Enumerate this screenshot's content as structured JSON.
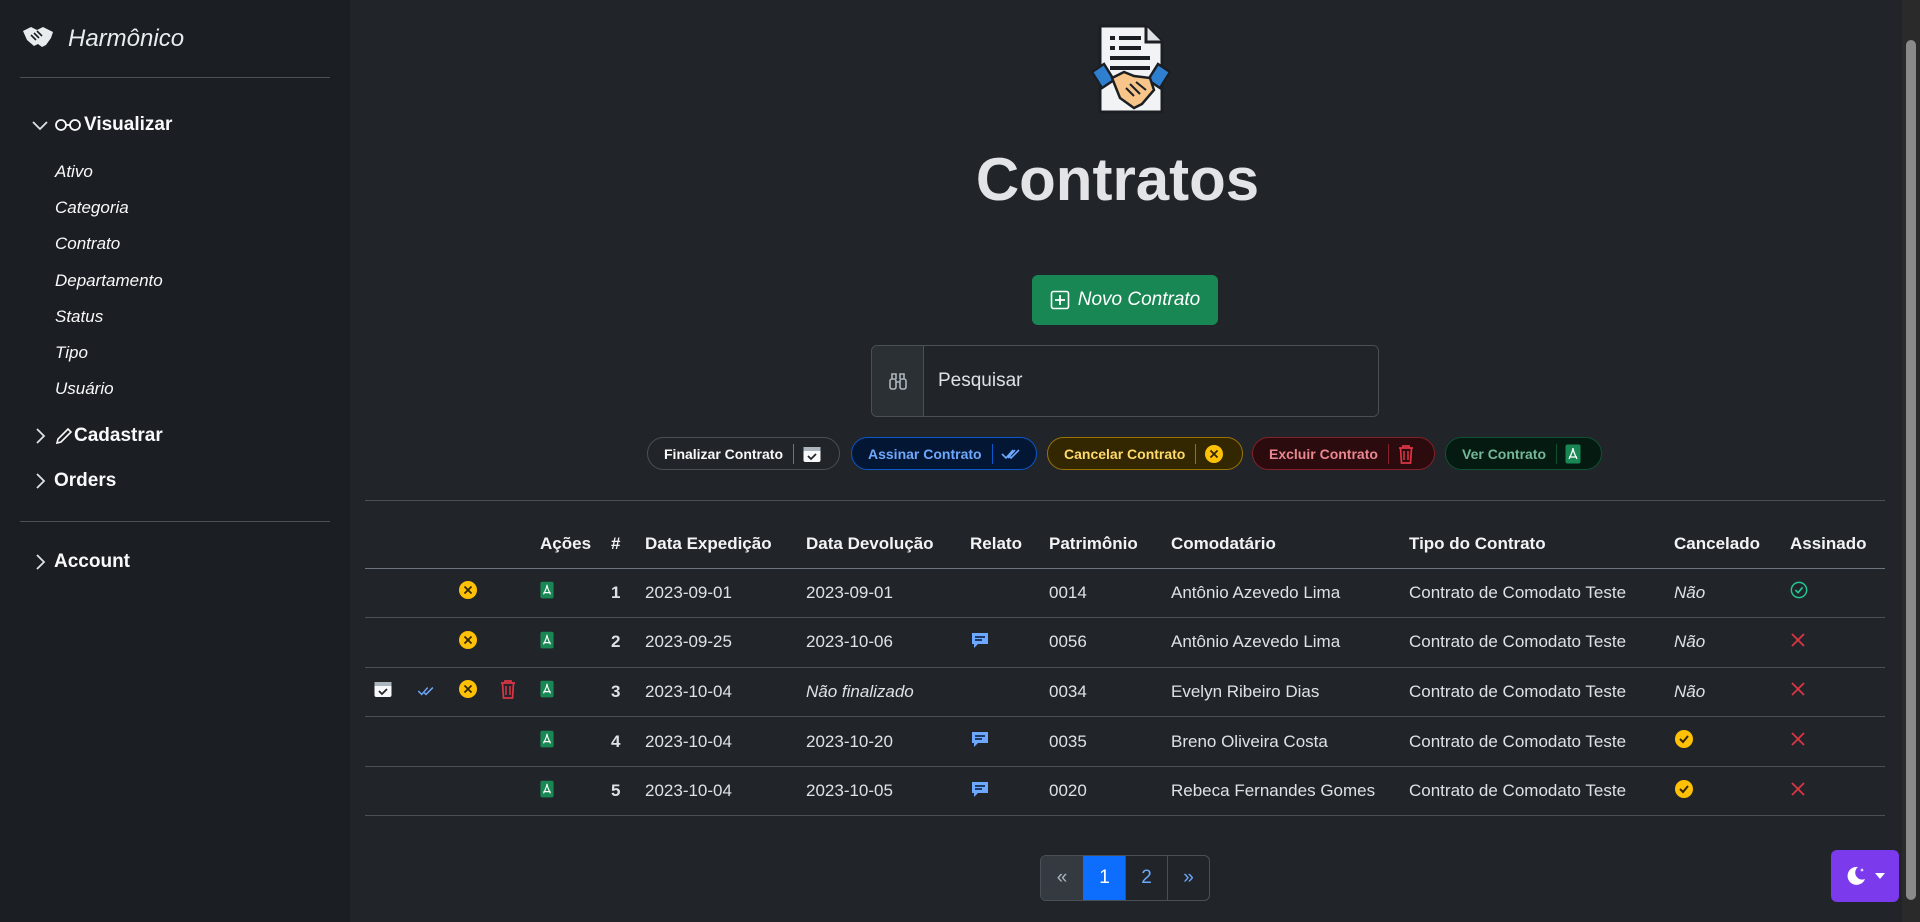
{
  "sidebar": {
    "brand": "Harmônico",
    "sections": {
      "visualizar": "Visualizar",
      "cadastrar": "Cadastrar",
      "orders": "Orders",
      "account": "Account"
    },
    "visualizar_items": [
      "Ativo",
      "Categoria",
      "Contrato",
      "Departamento",
      "Status",
      "Tipo",
      "Usuário"
    ]
  },
  "main": {
    "title": "Contratos",
    "new_button": "Novo Contrato",
    "search_placeholder": "Pesquisar"
  },
  "legend": [
    {
      "label": "Finalizar Contrato",
      "icon": "calendar-check-icon",
      "color": "#f8f9fa",
      "border": "#495057",
      "bg": "#212529"
    },
    {
      "label": "Assinar Contrato",
      "icon": "double-check-icon",
      "color": "#6ea8fe",
      "border": "#0a58ca",
      "bg": "#031633"
    },
    {
      "label": "Cancelar Contrato",
      "icon": "x-circle-fill-icon",
      "color": "#ffda6a",
      "border": "#997404",
      "bg": "#332701"
    },
    {
      "label": "Excluir Contrato",
      "icon": "trash-icon",
      "color": "#ea868f",
      "border": "#842029",
      "bg": "#2c0b0e"
    },
    {
      "label": "Ver Contrato",
      "icon": "file-pdf-icon",
      "color": "#75b798",
      "border": "#0f5132",
      "bg": "#051b11"
    }
  ],
  "table": {
    "headers": [
      "Ações",
      "#",
      "Data Expedição",
      "Data Devolução",
      "Relato",
      "Patrimônio",
      "Comodatário",
      "Tipo do Contrato",
      "Cancelado",
      "Assinado"
    ],
    "rows": [
      {
        "actions": {
          "finalize": false,
          "sign": false,
          "cancel": true,
          "delete": false,
          "view": true
        },
        "id": "1",
        "expedicao": "2023-09-01",
        "devolucao": "2023-09-01",
        "devolucao_italic": false,
        "relato": false,
        "patrimonio": "0014",
        "comodatario": "Antônio Azevedo Lima",
        "tipo": "Contrato de Comodato Teste",
        "cancelado": "Não",
        "assinado": true
      },
      {
        "actions": {
          "finalize": false,
          "sign": false,
          "cancel": true,
          "delete": false,
          "view": true
        },
        "id": "2",
        "expedicao": "2023-09-25",
        "devolucao": "2023-10-06",
        "devolucao_italic": false,
        "relato": true,
        "patrimonio": "0056",
        "comodatario": "Antônio Azevedo Lima",
        "tipo": "Contrato de Comodato Teste",
        "cancelado": "Não",
        "assinado": false
      },
      {
        "actions": {
          "finalize": true,
          "sign": true,
          "cancel": true,
          "delete": true,
          "view": true
        },
        "id": "3",
        "expedicao": "2023-10-04",
        "devolucao": "Não finalizado",
        "devolucao_italic": true,
        "relato": false,
        "patrimonio": "0034",
        "comodatario": "Evelyn Ribeiro Dias",
        "tipo": "Contrato de Comodato Teste",
        "cancelado": "Não",
        "assinado": false
      },
      {
        "actions": {
          "finalize": false,
          "sign": false,
          "cancel": false,
          "delete": false,
          "view": true
        },
        "id": "4",
        "expedicao": "2023-10-04",
        "devolucao": "2023-10-20",
        "devolucao_italic": false,
        "relato": true,
        "patrimonio": "0035",
        "comodatario": "Breno Oliveira Costa",
        "tipo": "Contrato de Comodato Teste",
        "cancelado": "check",
        "assinado": false
      },
      {
        "actions": {
          "finalize": false,
          "sign": false,
          "cancel": false,
          "delete": false,
          "view": true
        },
        "id": "5",
        "expedicao": "2023-10-04",
        "devolucao": "2023-10-05",
        "devolucao_italic": false,
        "relato": true,
        "patrimonio": "0020",
        "comodatario": "Rebeca Fernandes Gomes",
        "tipo": "Contrato de Comodato Teste",
        "cancelado": "check",
        "assinado": false
      }
    ]
  },
  "pagination": {
    "prev": "«",
    "pages": [
      "1",
      "2"
    ],
    "active": "1",
    "next": "»"
  },
  "colors": {
    "success": "#198754",
    "primary": "#0d6efd",
    "warning": "#ffc107",
    "danger": "#dc3545",
    "theme_button": "#7c3aed"
  }
}
